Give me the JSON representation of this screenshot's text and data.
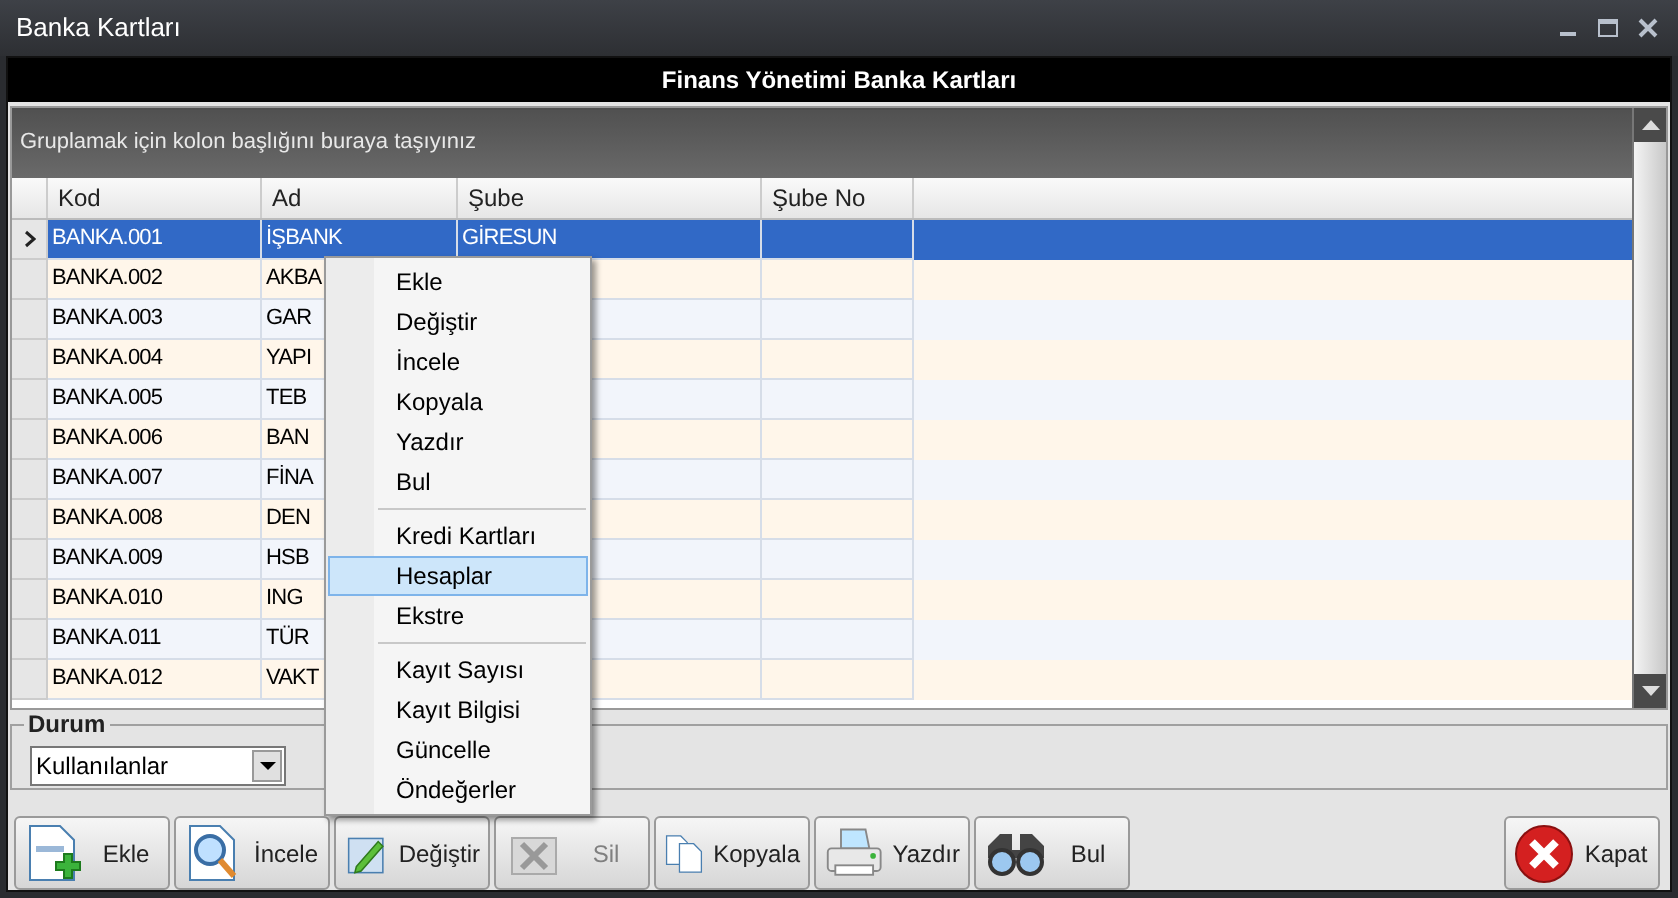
{
  "window": {
    "title": "Banka Kartları"
  },
  "header": {
    "title": "Finans Yönetimi Banka Kartları"
  },
  "group_panel": {
    "hint": "Gruplamak için kolon başlığını buraya taşıyınız"
  },
  "table": {
    "columns": [
      "Kod",
      "Ad",
      "Şube",
      "Şube No"
    ],
    "rows": [
      {
        "cells": [
          "BANKA.001",
          "İŞBANK",
          "GİRESUN",
          ""
        ],
        "selected": true
      },
      {
        "cells": [
          "BANKA.002",
          "AKBA",
          "",
          ""
        ],
        "selected": false
      },
      {
        "cells": [
          "BANKA.003",
          "GAR",
          "",
          ""
        ],
        "selected": false
      },
      {
        "cells": [
          "BANKA.004",
          "YAPI",
          "",
          ""
        ],
        "selected": false
      },
      {
        "cells": [
          "BANKA.005",
          "TEB",
          "",
          ""
        ],
        "selected": false
      },
      {
        "cells": [
          "BANKA.006",
          "BAN",
          "",
          ""
        ],
        "selected": false
      },
      {
        "cells": [
          "BANKA.007",
          "FİNA",
          "",
          ""
        ],
        "selected": false
      },
      {
        "cells": [
          "BANKA.008",
          "DEN",
          "",
          ""
        ],
        "selected": false
      },
      {
        "cells": [
          "BANKA.009",
          "HSB",
          "",
          ""
        ],
        "selected": false
      },
      {
        "cells": [
          "BANKA.010",
          "ING",
          "",
          ""
        ],
        "selected": false
      },
      {
        "cells": [
          "BANKA.011",
          "TÜR",
          "",
          ""
        ],
        "selected": false
      },
      {
        "cells": [
          "BANKA.012",
          "VAKT",
          "",
          ""
        ],
        "selected": false
      }
    ]
  },
  "context_menu": {
    "groups": [
      [
        {
          "label": "Ekle",
          "selected": false
        },
        {
          "label": "Değiştir",
          "selected": false
        },
        {
          "label": "İncele",
          "selected": false
        },
        {
          "label": "Kopyala",
          "selected": false
        },
        {
          "label": "Yazdır",
          "selected": false
        },
        {
          "label": "Bul",
          "selected": false
        }
      ],
      [
        {
          "label": "Kredi Kartları",
          "selected": false
        },
        {
          "label": "Hesaplar",
          "selected": true
        },
        {
          "label": "Ekstre",
          "selected": false
        }
      ],
      [
        {
          "label": "Kayıt Sayısı",
          "selected": false
        },
        {
          "label": "Kayıt Bilgisi",
          "selected": false
        },
        {
          "label": "Güncelle",
          "selected": false
        },
        {
          "label": "Öndeğerler",
          "selected": false
        }
      ]
    ]
  },
  "status_group": {
    "title": "Durum",
    "value": "Kullanılanlar"
  },
  "buttons": [
    {
      "kind": "add",
      "label": "Ekle",
      "disabled": false
    },
    {
      "kind": "inspect",
      "label": "İncele",
      "disabled": false
    },
    {
      "kind": "edit",
      "label": "Değiştir",
      "disabled": false
    },
    {
      "kind": "delete",
      "label": "Sil",
      "disabled": true
    },
    {
      "kind": "copy",
      "label": "Kopyala",
      "disabled": false
    },
    {
      "kind": "print",
      "label": "Yazdır",
      "disabled": false
    },
    {
      "kind": "find",
      "label": "Bul",
      "disabled": false
    }
  ],
  "close_button": {
    "label": "Kapat"
  }
}
